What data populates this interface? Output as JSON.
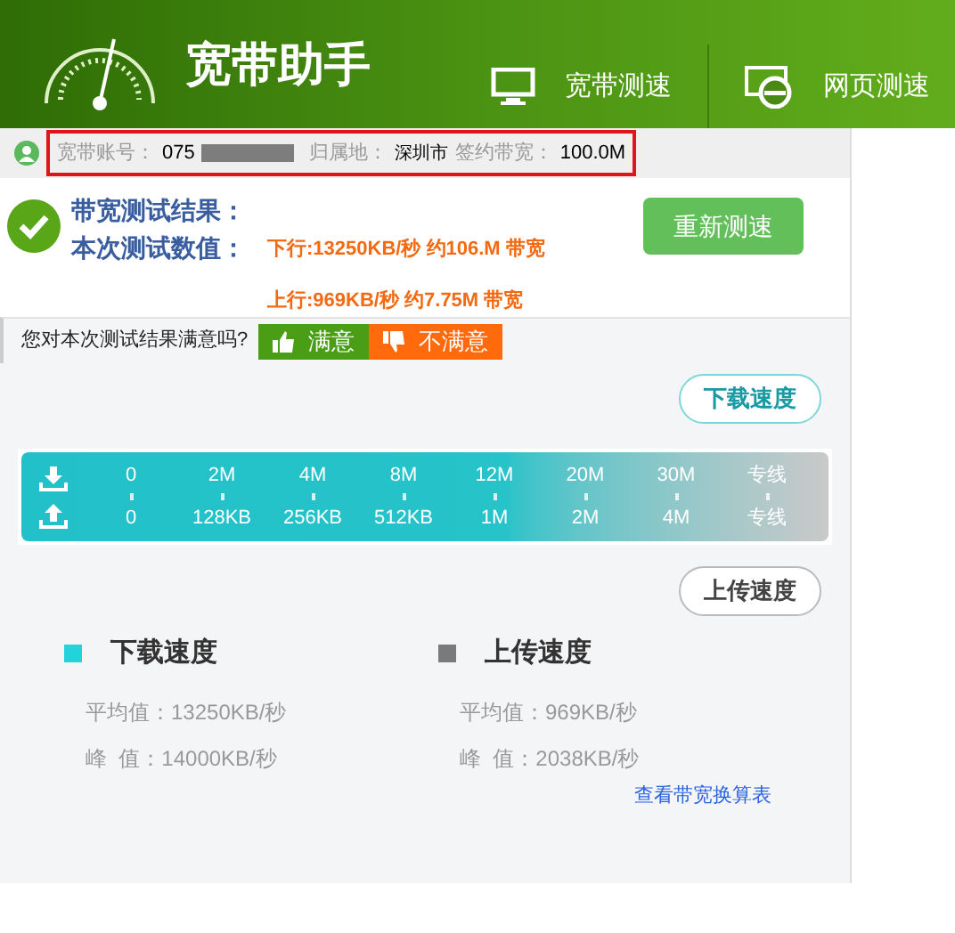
{
  "header": {
    "title": "宽带助手",
    "tabs": [
      {
        "label": "宽带测速",
        "kind": "monitor"
      },
      {
        "label": "网页测速",
        "kind": "browser"
      }
    ]
  },
  "account_bar": {
    "account_label": "宽带账号：",
    "account_value": "075",
    "region_label": "归属地：",
    "region_value": "深圳市",
    "bandwidth_label": "签约带宽：",
    "bandwidth_value": "100.0M"
  },
  "result": {
    "title": "带宽测试结果：",
    "subtitle": "本次测试数值：",
    "download": "下行:13250KB/秒 约106.M 带宽",
    "upload": "上行:969KB/秒 约7.75M 带宽",
    "retest_button": "重新测速"
  },
  "feedback": {
    "question": "您对本次测试结果满意吗?",
    "buttons": [
      {
        "label": "满意",
        "kind": "like"
      },
      {
        "label": "不满意",
        "kind": "dislike"
      }
    ]
  },
  "scale": {
    "download_bubble": "下载速度",
    "upload_bubble": "上传速度",
    "download_marks": [
      "0",
      "2M",
      "4M",
      "8M",
      "12M",
      "20M",
      "30M",
      "专线"
    ],
    "upload_marks": [
      "0",
      "128KB",
      "256KB",
      "512KB",
      "1M",
      "2M",
      "4M",
      "专线"
    ]
  },
  "legend": [
    {
      "title": "下载速度",
      "color": "#22d3da",
      "average": "平均值：13250KB/秒",
      "peak": "峰  值：14000KB/秒"
    },
    {
      "title": "上传速度",
      "color": "#7a7a7a",
      "average": "平均值：969KB/秒",
      "peak": "峰  值：2038KB/秒"
    }
  ],
  "conversion_link": "查看带宽换算表"
}
